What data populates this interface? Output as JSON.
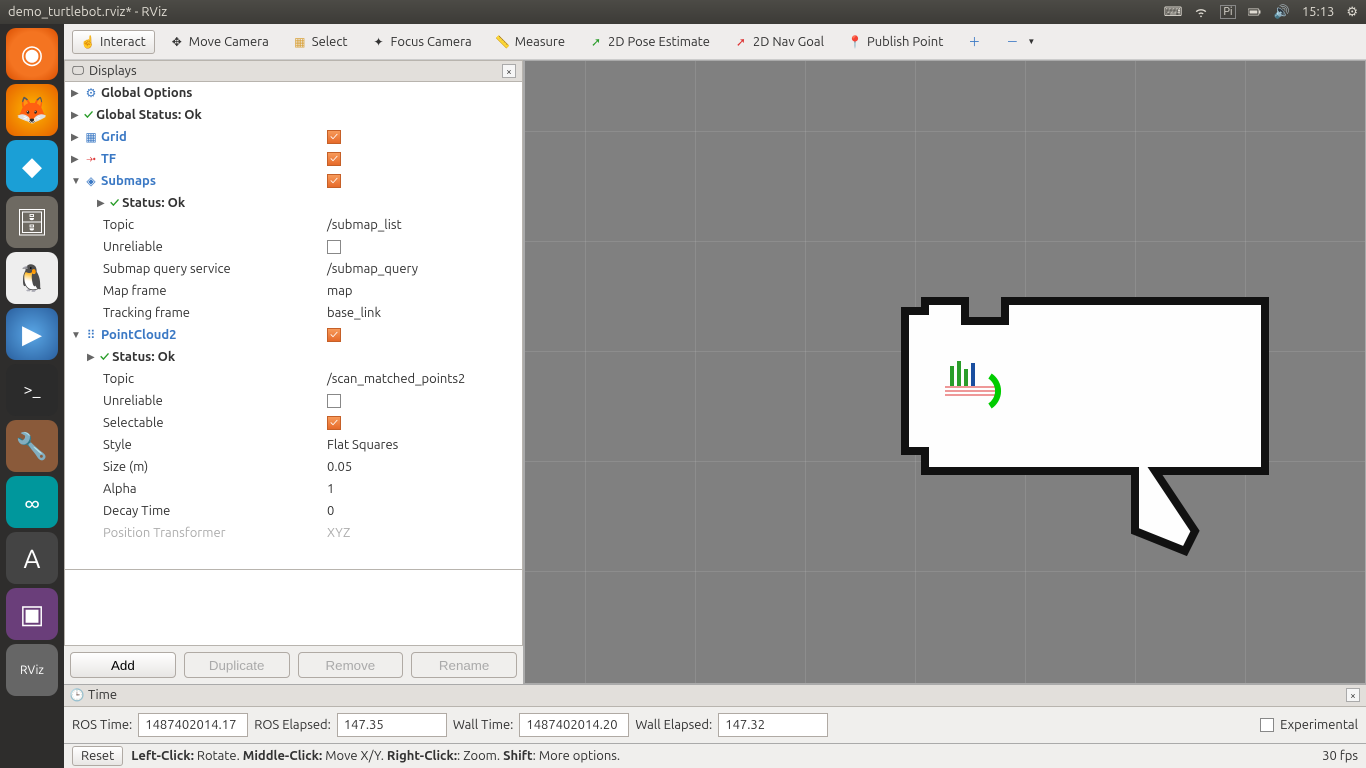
{
  "menubar": {
    "title": "demo_turtlebot.rviz* - RViz",
    "time": "15:13"
  },
  "toolbar": {
    "interact": "Interact",
    "move_camera": "Move Camera",
    "select": "Select",
    "focus_camera": "Focus Camera",
    "measure": "Measure",
    "pose_estimate": "2D Pose Estimate",
    "nav_goal": "2D Nav Goal",
    "publish_point": "Publish Point"
  },
  "displays": {
    "panel_title": "Displays",
    "items": {
      "global_options": "Global Options",
      "global_status": "Global Status: Ok",
      "grid": "Grid",
      "tf": "TF",
      "submaps": {
        "label": "Submaps",
        "status": "Status: Ok",
        "topic_label": "Topic",
        "topic_value": "/submap_list",
        "unreliable_label": "Unreliable",
        "query_label": "Submap query service",
        "query_value": "/submap_query",
        "mapframe_label": "Map frame",
        "mapframe_value": "map",
        "tracking_label": "Tracking frame",
        "tracking_value": "base_link"
      },
      "pointcloud": {
        "label": "PointCloud2",
        "status": "Status: Ok",
        "topic_label": "Topic",
        "topic_value": "/scan_matched_points2",
        "unreliable_label": "Unreliable",
        "selectable_label": "Selectable",
        "style_label": "Style",
        "style_value": "Flat Squares",
        "size_label": "Size (m)",
        "size_value": "0.05",
        "alpha_label": "Alpha",
        "alpha_value": "1",
        "decay_label": "Decay Time",
        "decay_value": "0",
        "pos_label": "Position Transformer",
        "pos_value": "XYZ"
      }
    },
    "buttons": {
      "add": "Add",
      "duplicate": "Duplicate",
      "remove": "Remove",
      "rename": "Rename"
    }
  },
  "time": {
    "panel_title": "Time",
    "ros_time_label": "ROS Time:",
    "ros_time_value": "1487402014.17",
    "ros_elapsed_label": "ROS Elapsed:",
    "ros_elapsed_value": "147.35",
    "wall_time_label": "Wall Time:",
    "wall_time_value": "1487402014.20",
    "wall_elapsed_label": "Wall Elapsed:",
    "wall_elapsed_value": "147.32",
    "experimental": "Experimental"
  },
  "statusbar": {
    "reset": "Reset",
    "hint": "Left-Click: Rotate. Middle-Click: Move X/Y. Right-Click:: Zoom. Shift: More options.",
    "fps": "30 fps"
  }
}
